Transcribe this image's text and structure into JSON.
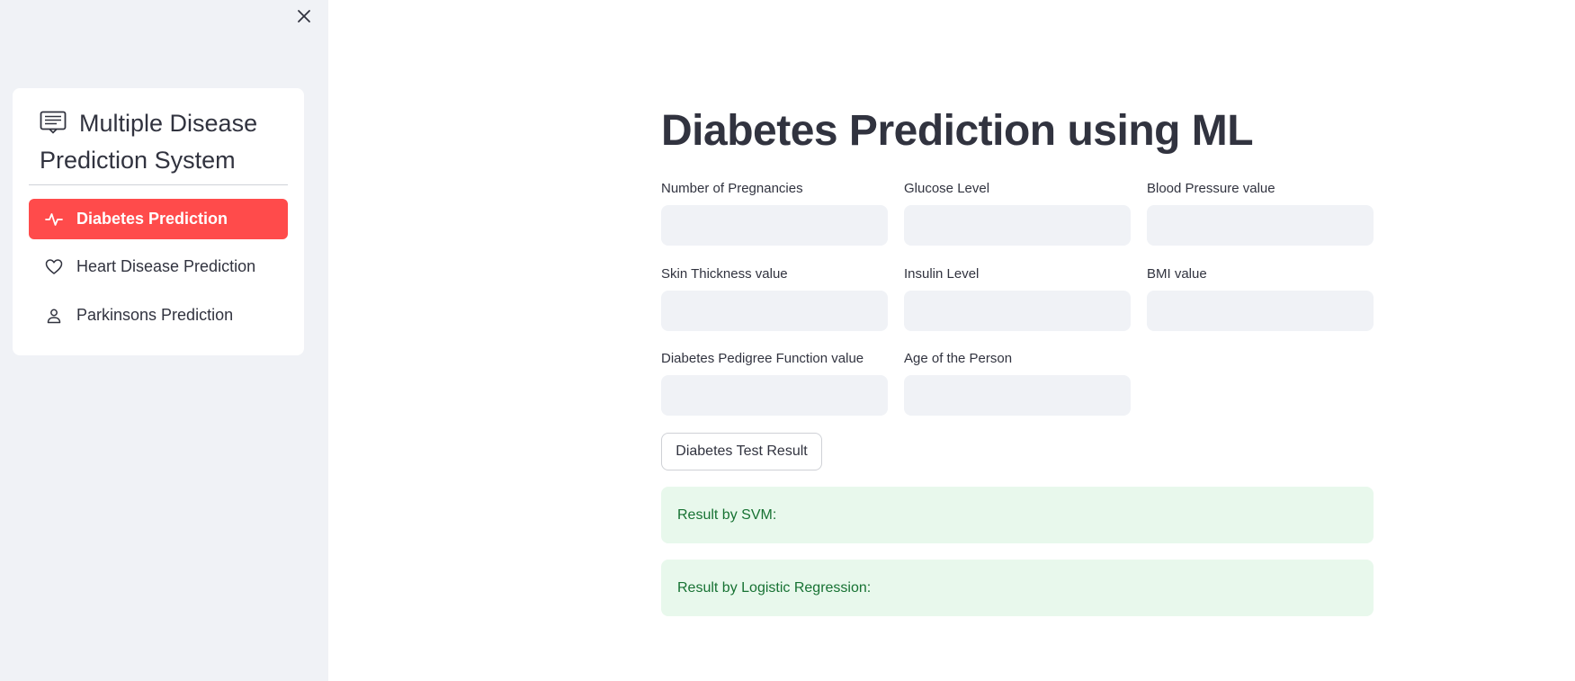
{
  "sidebar": {
    "close_icon": "close-icon",
    "menu_title": "Multiple Disease Prediction System",
    "menu_title_icon": "list-card-icon",
    "items": [
      {
        "label": "Diabetes Prediction",
        "icon": "activity-icon",
        "active": true
      },
      {
        "label": "Heart Disease Prediction",
        "icon": "heart-icon",
        "active": false
      },
      {
        "label": "Parkinsons Prediction",
        "icon": "person-icon",
        "active": false
      }
    ],
    "active_color": "#ff4b4b"
  },
  "main": {
    "title": "Diabetes Prediction using ML",
    "fields": [
      {
        "label": "Number of Pregnancies",
        "value": ""
      },
      {
        "label": "Glucose Level",
        "value": ""
      },
      {
        "label": "Blood Pressure value",
        "value": ""
      },
      {
        "label": "Skin Thickness value",
        "value": ""
      },
      {
        "label": "Insulin Level",
        "value": ""
      },
      {
        "label": "BMI value",
        "value": ""
      },
      {
        "label": "Diabetes Pedigree Function value",
        "value": ""
      },
      {
        "label": "Age of the Person",
        "value": ""
      }
    ],
    "submit_label": "Diabetes Test Result",
    "results": [
      {
        "text": "Result by SVM:"
      },
      {
        "text": "Result by Logistic Regression:"
      }
    ],
    "result_bg_color": "#e8f8ec",
    "result_text_color": "#177233"
  }
}
